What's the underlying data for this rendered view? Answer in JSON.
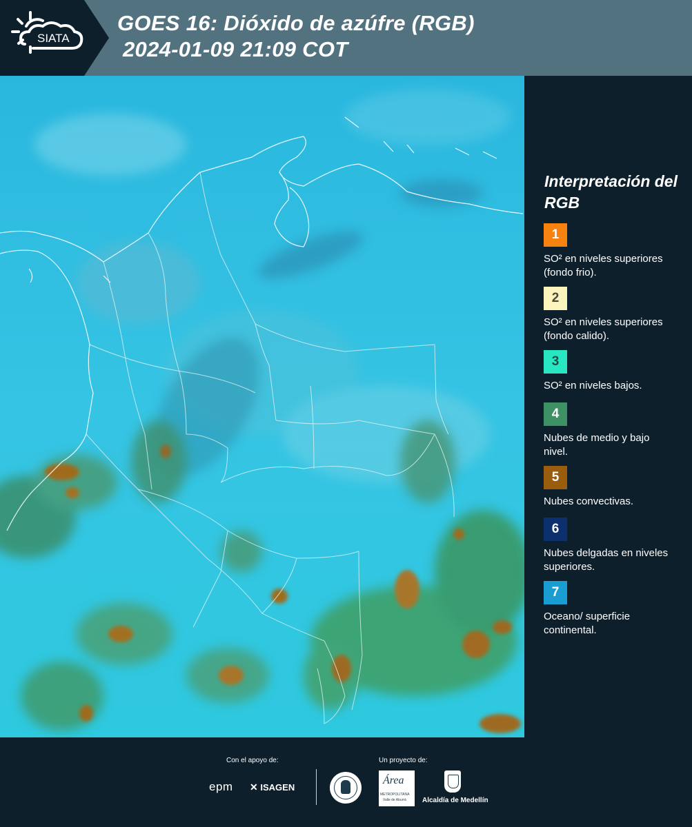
{
  "header": {
    "logo_text": "SIATA",
    "title_line1": "GOES 16: Dióxido de azúfre (RGB)",
    "title_line2": "2024-01-09 21:09 COT"
  },
  "legend": {
    "title": "Interpretación del RGB",
    "items": [
      {
        "number": "1",
        "color": "#f7820f",
        "text_color": "#ffffff",
        "label": "SO² en niveles superiores (fondo frio)."
      },
      {
        "number": "2",
        "color": "#fbf4bd",
        "text_color": "#4a4a3a",
        "label": "SO² en niveles superiores (fondo calido)."
      },
      {
        "number": "3",
        "color": "#29e6c3",
        "text_color": "#1d4f46",
        "label": "SO² en niveles bajos."
      },
      {
        "number": "4",
        "color": "#3e9165",
        "text_color": "#ffffff",
        "label": "Nubes de medio y bajo nivel."
      },
      {
        "number": "5",
        "color": "#9a5d0d",
        "text_color": "#ffffff",
        "label": "Nubes convectivas."
      },
      {
        "number": "6",
        "color": "#0c2f6e",
        "text_color": "#ffffff",
        "label": "Nubes delgadas en niveles superiores."
      },
      {
        "number": "7",
        "color": "#1a9dd2",
        "text_color": "#ffffff",
        "label": "Oceano/ superficie continental."
      }
    ]
  },
  "footer": {
    "support_label": "Con el apoyo de:",
    "project_label": "Un proyecto de:",
    "logo_epm": "epm",
    "logo_isagen": "ISAGEN",
    "logo_area": "Área",
    "logo_area_sub": "METROPOLITANA",
    "logo_area_sub2": "Valle de Aburrá",
    "logo_alcaldia": "Alcaldía de Medellín"
  },
  "colors": {
    "header_bg": "#53727f",
    "panel_bg": "#0e1f2c",
    "map_base": "#2fbde0"
  }
}
